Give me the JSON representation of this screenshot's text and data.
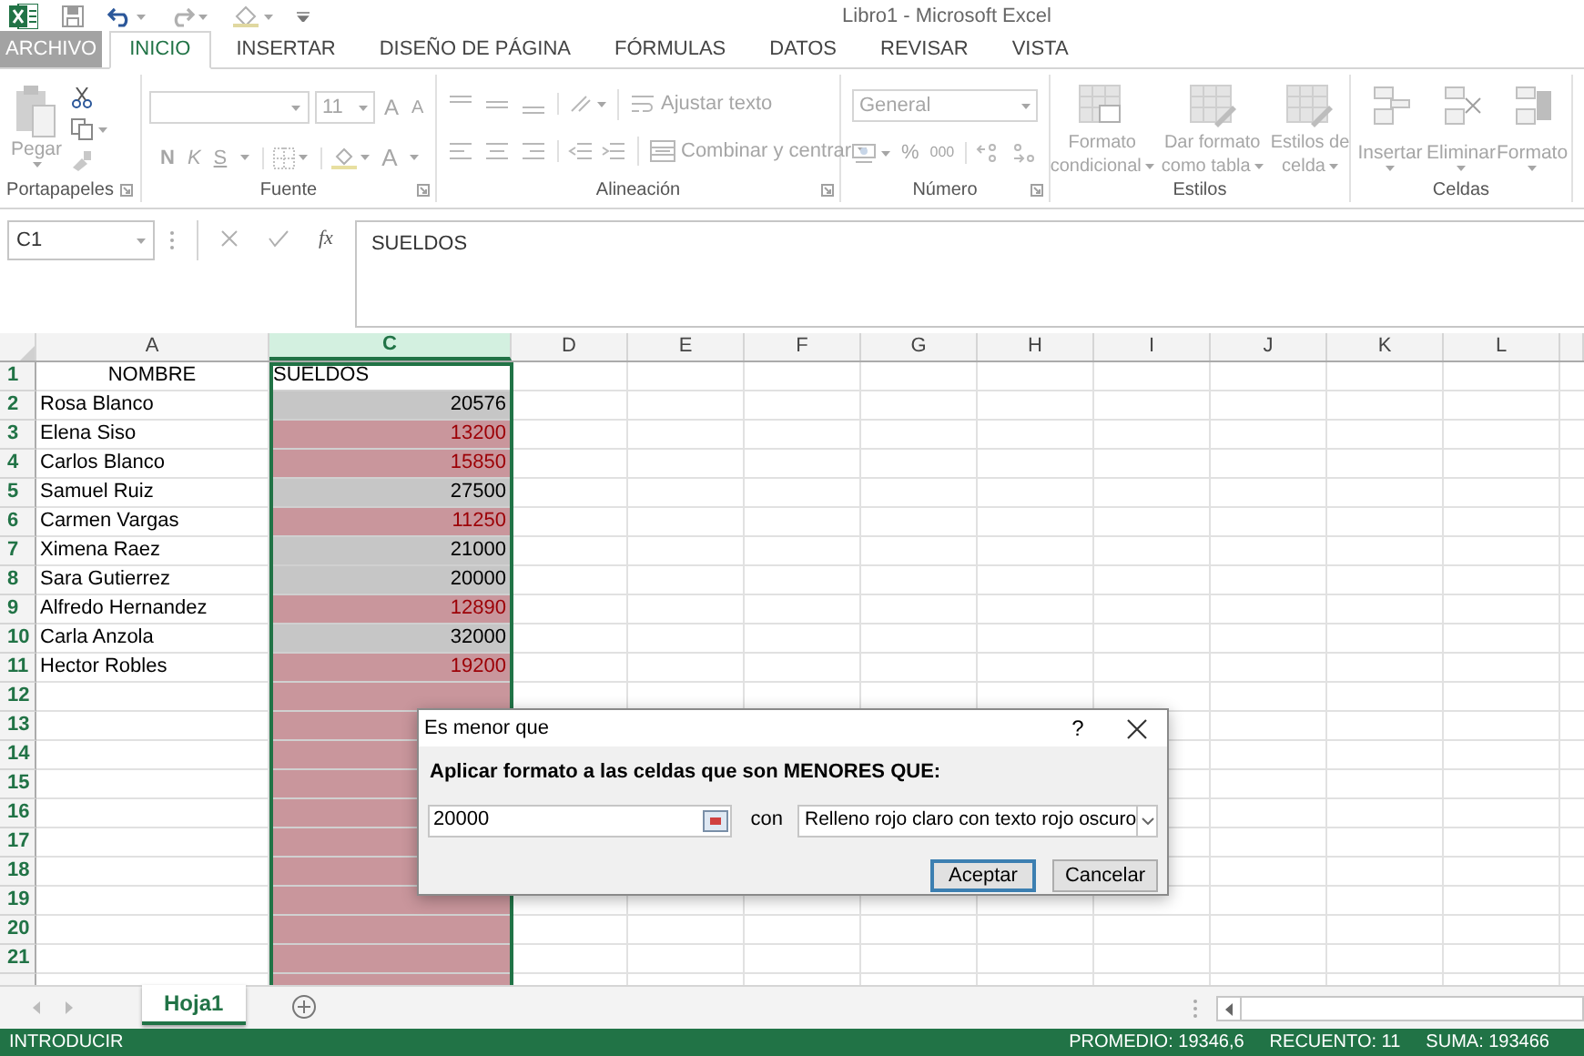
{
  "window": {
    "title": "Libro1 - Microsoft Excel"
  },
  "tabs": [
    {
      "label": "ARCHIVO",
      "selected": false,
      "kind": "file"
    },
    {
      "label": "INICIO",
      "selected": true,
      "kind": "tab"
    },
    {
      "label": "INSERTAR",
      "selected": false,
      "kind": "tab"
    },
    {
      "label": "DISEÑO DE PÁGINA",
      "selected": false,
      "kind": "tab"
    },
    {
      "label": "FÓRMULAS",
      "selected": false,
      "kind": "tab"
    },
    {
      "label": "DATOS",
      "selected": false,
      "kind": "tab"
    },
    {
      "label": "REVISAR",
      "selected": false,
      "kind": "tab"
    },
    {
      "label": "VISTA",
      "selected": false,
      "kind": "tab"
    }
  ],
  "ribbon_groups": [
    {
      "kind": "clipboard",
      "label": "Portapapeles",
      "paste": "Pegar"
    },
    {
      "kind": "font",
      "label": "Fuente",
      "size": "11",
      "grow": "A",
      "shrink": "A",
      "bold": "N",
      "italic": "K",
      "underline": "S",
      "font_color": "A"
    },
    {
      "kind": "alignment",
      "label": "Alineación",
      "wrap": "Ajustar texto",
      "merge": "Combinar y centrar"
    },
    {
      "kind": "number",
      "label": "Número",
      "format": "General",
      "percent": "%",
      "thousands": "000"
    },
    {
      "kind": "styles",
      "label": "Estilos",
      "buttons": [
        {
          "lines": [
            "Formato",
            "condicional"
          ]
        },
        {
          "lines": [
            "Dar formato",
            "como tabla"
          ]
        },
        {
          "lines": [
            "Estilos de",
            "celda"
          ]
        }
      ]
    },
    {
      "kind": "cells",
      "label": "Celdas",
      "buttons": [
        "Insertar",
        "Eliminar",
        "Formato"
      ]
    }
  ],
  "formula_bar": {
    "name_box": "C1",
    "fx": "fx",
    "formula": "SUELDOS"
  },
  "columns": [
    {
      "label": "A",
      "selected": false
    },
    {
      "label": "C",
      "selected": true
    },
    {
      "label": "D",
      "selected": false
    },
    {
      "label": "E",
      "selected": false
    },
    {
      "label": "F",
      "selected": false
    },
    {
      "label": "G",
      "selected": false
    },
    {
      "label": "H",
      "selected": false
    },
    {
      "label": "I",
      "selected": false
    },
    {
      "label": "J",
      "selected": false
    },
    {
      "label": "K",
      "selected": false
    },
    {
      "label": "L",
      "selected": false
    }
  ],
  "rows": [
    {
      "n": "1",
      "a": "NOMBRE",
      "c": "SUELDOS",
      "highlighted": false,
      "header": true
    },
    {
      "n": "2",
      "a": "Rosa Blanco",
      "c": "20576",
      "highlighted": false
    },
    {
      "n": "3",
      "a": "Elena Siso",
      "c": "13200",
      "highlighted": true
    },
    {
      "n": "4",
      "a": "Carlos Blanco",
      "c": "15850",
      "highlighted": true
    },
    {
      "n": "5",
      "a": "Samuel Ruiz",
      "c": "27500",
      "highlighted": false
    },
    {
      "n": "6",
      "a": "Carmen Vargas",
      "c": "11250",
      "highlighted": true
    },
    {
      "n": "7",
      "a": "Ximena Raez",
      "c": "21000",
      "highlighted": false
    },
    {
      "n": "8",
      "a": "Sara Gutierrez",
      "c": "20000",
      "highlighted": false
    },
    {
      "n": "9",
      "a": "Alfredo Hernandez",
      "c": "12890",
      "highlighted": true
    },
    {
      "n": "10",
      "a": "Carla Anzola",
      "c": "32000",
      "highlighted": false
    },
    {
      "n": "11",
      "a": "Hector Robles",
      "c": "19200",
      "highlighted": true
    },
    {
      "n": "12",
      "highlighted": true
    },
    {
      "n": "13",
      "highlighted": true
    },
    {
      "n": "14",
      "highlighted": true
    },
    {
      "n": "15",
      "highlighted": true
    },
    {
      "n": "16",
      "highlighted": true
    },
    {
      "n": "17",
      "highlighted": true
    },
    {
      "n": "18",
      "highlighted": true
    },
    {
      "n": "19",
      "highlighted": true
    },
    {
      "n": "20",
      "highlighted": true
    },
    {
      "n": "21",
      "highlighted": true
    }
  ],
  "dialog": {
    "title": "Es menor que",
    "help": "?",
    "prompt": "Aplicar formato a las celdas que son MENORES QUE:",
    "value": "20000",
    "joiner": "con",
    "format": "Relleno rojo claro con texto rojo oscuro",
    "buttons": [
      {
        "label": "Aceptar",
        "default": true
      },
      {
        "label": "Cancelar",
        "default": false
      }
    ]
  },
  "sheets": [
    {
      "label": "Hoja1",
      "selected": true
    }
  ],
  "status_bar": {
    "mode": "INTRODUCIR",
    "stats": [
      "PROMEDIO: 19346,6",
      "RECUENTO: 11",
      "SUMA: 193466"
    ]
  }
}
